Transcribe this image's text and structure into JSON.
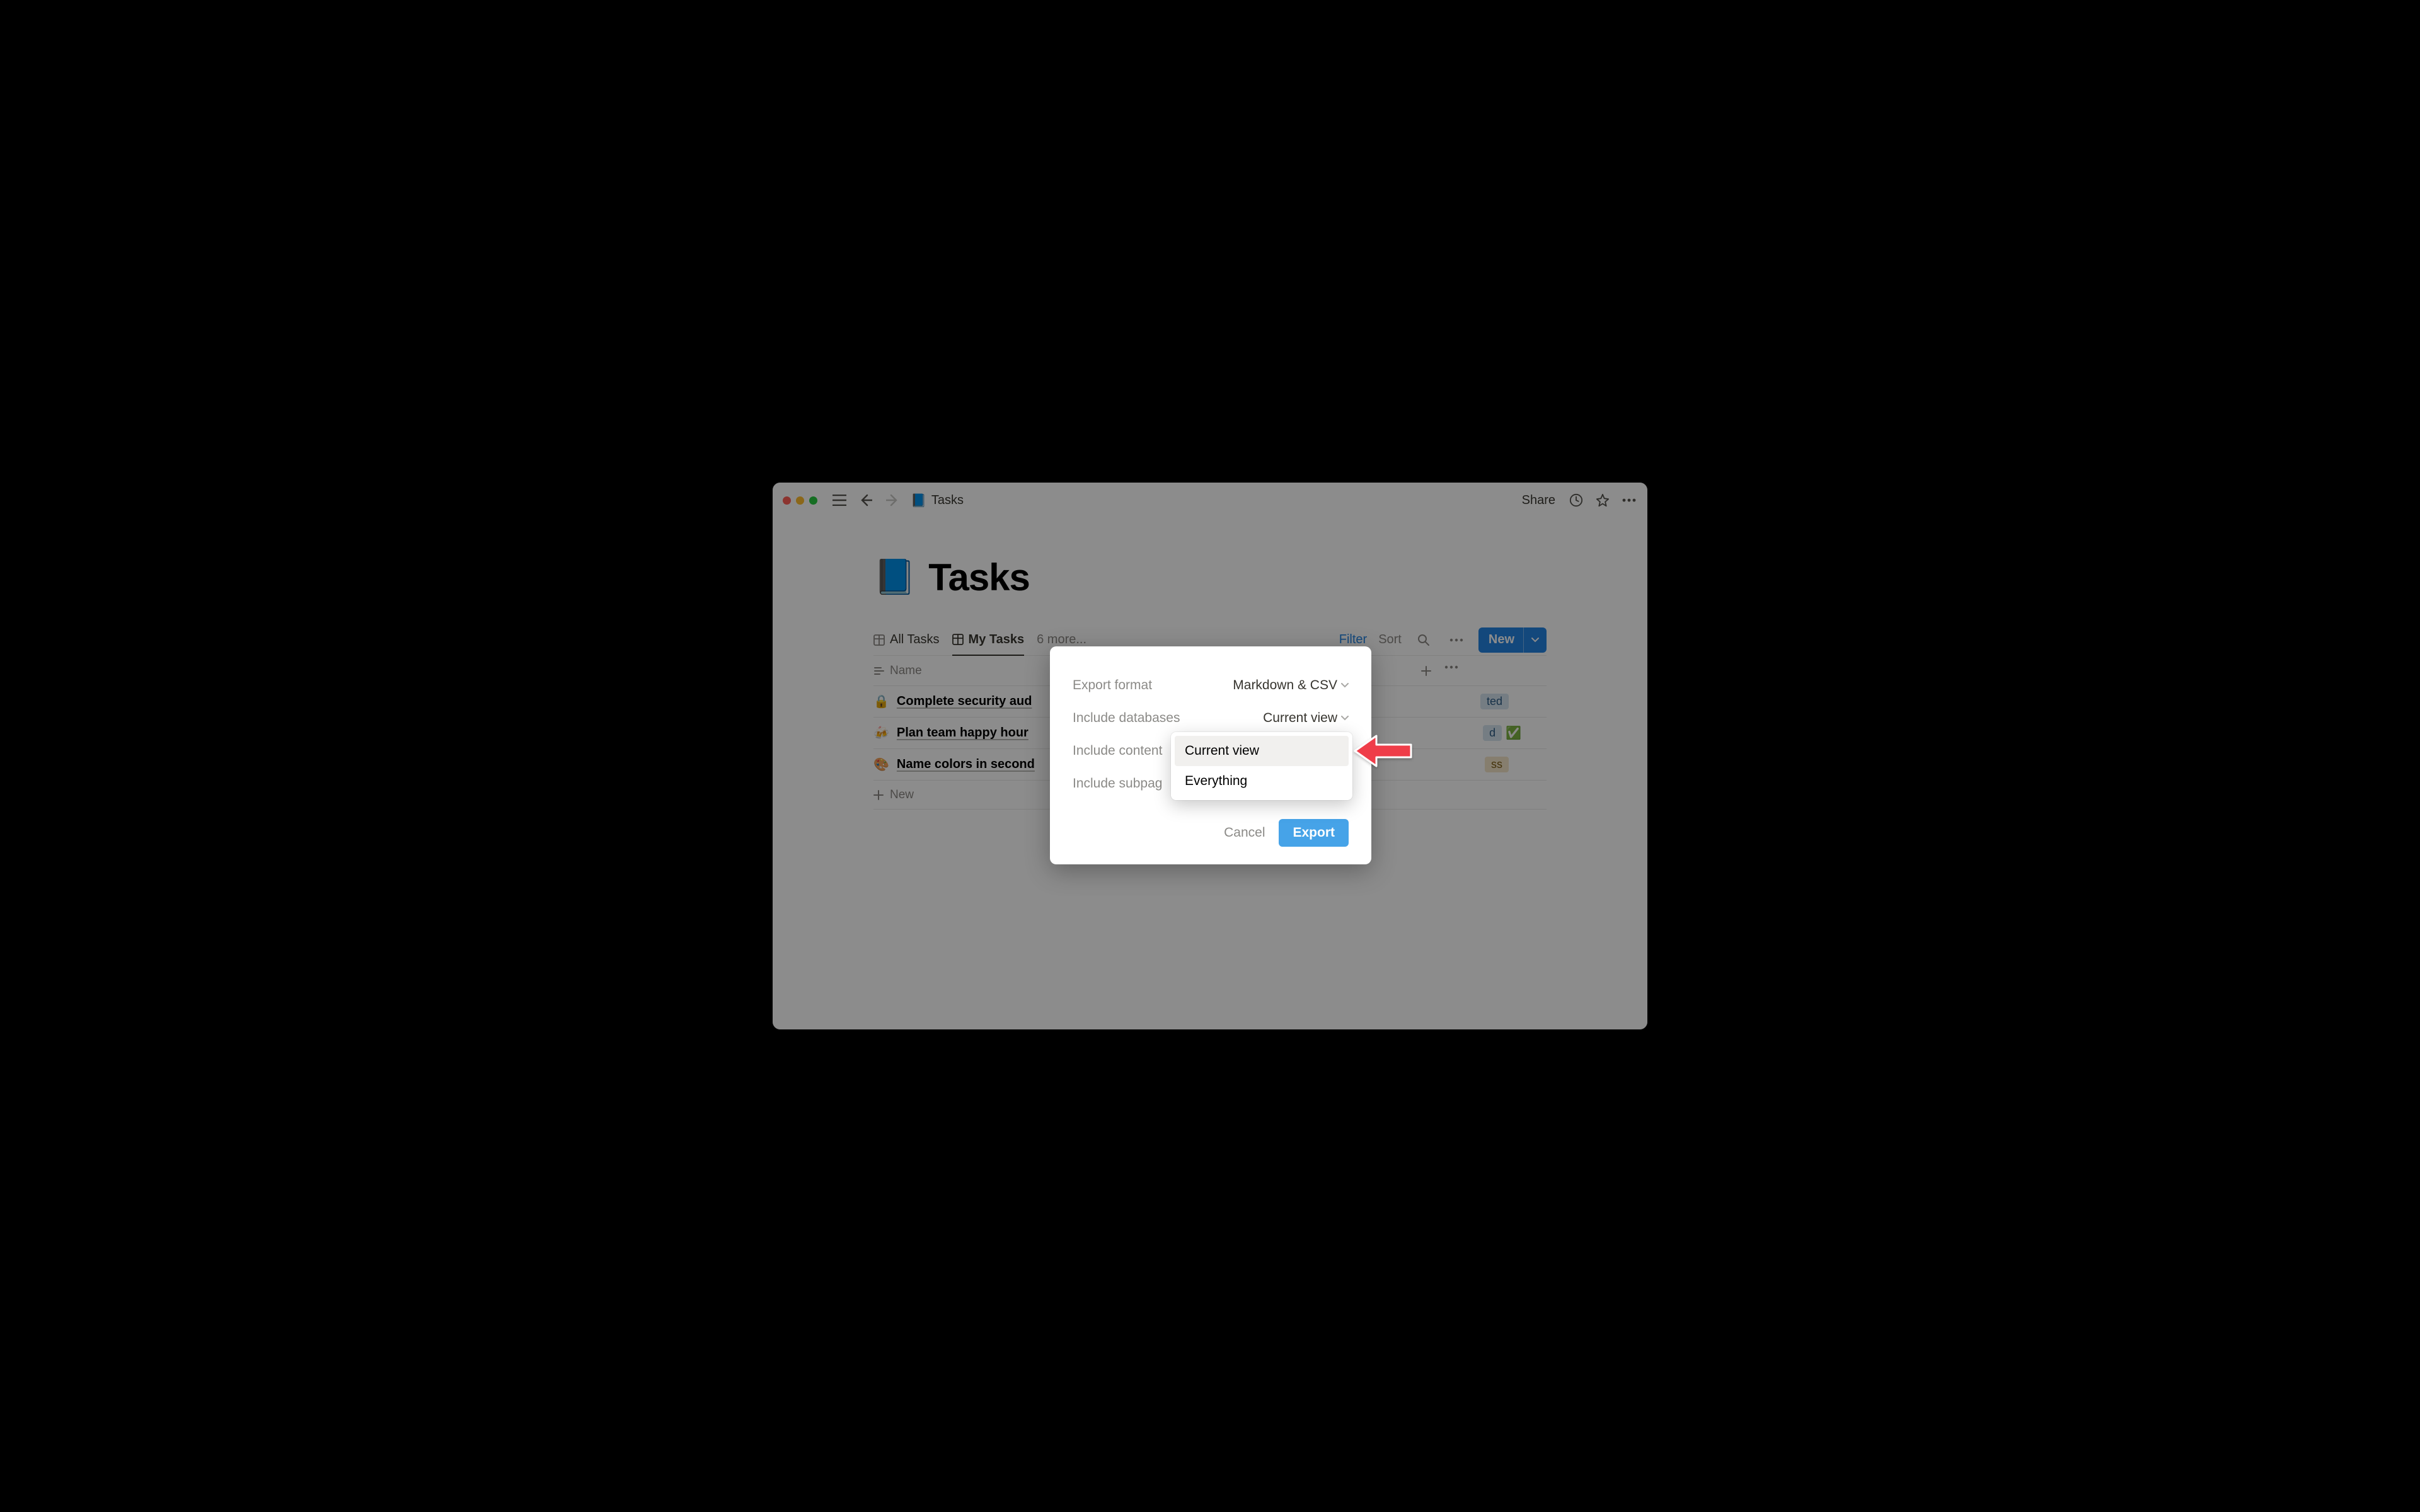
{
  "topbar": {
    "crumb_icon": "📘",
    "crumb_label": "Tasks",
    "share": "Share"
  },
  "page": {
    "icon": "📘",
    "title": "Tasks"
  },
  "tabs": {
    "all": "All Tasks",
    "mine": "My Tasks",
    "more": "6 more...",
    "filter": "Filter",
    "sort": "Sort",
    "new": "New"
  },
  "columns": {
    "name": "Name"
  },
  "rows": [
    {
      "icon": "🔒",
      "name": "Complete security aud",
      "status_label": "ted",
      "status_class": "completed",
      "check": ""
    },
    {
      "icon": "🍻",
      "name": "Plan team happy hour",
      "status_label": "d",
      "status_class": "completed",
      "check": "✅"
    },
    {
      "icon": "🎨",
      "name": "Name colors in second",
      "status_label": "ss",
      "status_class": "inprog",
      "check": ""
    }
  ],
  "add_row": "New",
  "modal": {
    "rows": [
      {
        "label": "Export format",
        "value": "Markdown & CSV"
      },
      {
        "label": "Include databases",
        "value": "Current view"
      },
      {
        "label": "Include content",
        "value": ""
      },
      {
        "label": "Include subpag",
        "value": ""
      }
    ],
    "cancel": "Cancel",
    "export": "Export"
  },
  "dropdown": {
    "opt1": "Current view",
    "opt2": "Everything"
  }
}
